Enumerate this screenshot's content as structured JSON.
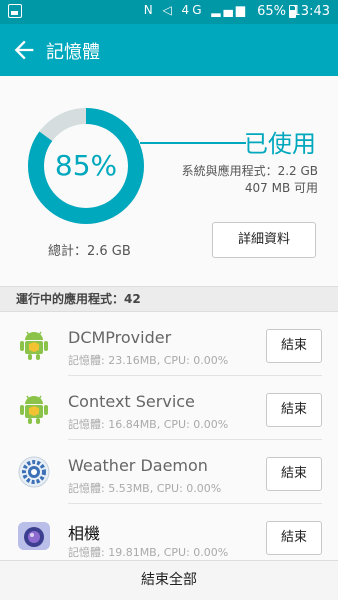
{
  "status_bar": {
    "battery": "65%",
    "time": "13:43",
    "network": "4G"
  },
  "app_bar": {
    "title": "記憶體"
  },
  "memory": {
    "percent_label": "85%",
    "percent_value": 85,
    "used_label": "已使用",
    "system_apps": "系統與應用程式：2.2 GB",
    "available": "407 MB 可用",
    "total": "總計：2.6 GB",
    "detail_button": "詳細資料"
  },
  "running_header": "運行中的應用程式：42",
  "apps": [
    {
      "name": "DCMProvider",
      "meta": "記憶體: 23.16MB, CPU: 0.00%",
      "icon": "android-icon",
      "end_label": "結束"
    },
    {
      "name": "Context Service",
      "meta": "記憶體: 16.84MB, CPU: 0.00%",
      "icon": "android-icon",
      "end_label": "結束"
    },
    {
      "name": "Weather Daemon",
      "meta": "記憶體: 5.53MB, CPU: 0.00%",
      "icon": "weather-gear-icon",
      "end_label": "結束"
    },
    {
      "name": "相機",
      "meta": "記憶體: 19.81MB, CPU: 0.00%",
      "icon": "camera-icon",
      "end_label": "結束"
    }
  ],
  "bottom_button": "結束全部",
  "colors": {
    "accent": "#00a8be",
    "ring_track": "#d5dddf"
  }
}
